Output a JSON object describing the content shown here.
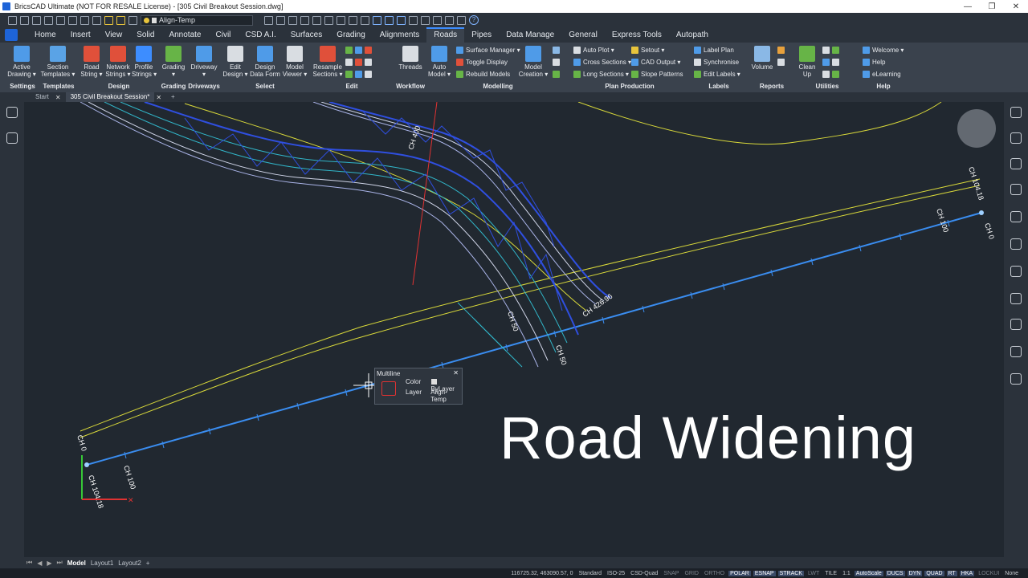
{
  "window": {
    "title": "BricsCAD Ultimate (NOT FOR RESALE License) - [305 Civil Breakout Session.dwg]",
    "min": "—",
    "max": "❐",
    "close": "✕"
  },
  "quick_access": {
    "layer": "Align-Temp",
    "help": "?"
  },
  "ribbon_tabs": [
    "Home",
    "Insert",
    "View",
    "Solid",
    "Annotate",
    "Civil",
    "CSD A.I.",
    "Surfaces",
    "Grading",
    "Alignments",
    "Roads",
    "Pipes",
    "Data Manage",
    "General",
    "Express Tools",
    "Autopath"
  ],
  "active_tab": "Roads",
  "ribbon": {
    "buttons": [
      {
        "label": "Active\nDrawing ▾",
        "icon": "active-drawing-icon",
        "color": "#4f9be8"
      },
      {
        "label": "Section\nTemplates ▾",
        "icon": "section-templates-icon",
        "color": "#5aa3e6"
      },
      {
        "label": "Road\nString ▾",
        "icon": "road-string-icon",
        "color": "#e0503a"
      },
      {
        "label": "Network\nStrings ▾",
        "icon": "network-strings-icon",
        "color": "#e0503a"
      },
      {
        "label": "Profile\nStrings ▾",
        "icon": "profile-strings-icon",
        "color": "#3d8dff"
      },
      {
        "label": "Grading\n▾",
        "icon": "grading-icon",
        "color": "#67b447"
      },
      {
        "label": "Driveway\n▾",
        "icon": "driveway-icon",
        "color": "#4f9be8"
      },
      {
        "label": "Edit\nDesign ▾",
        "icon": "edit-design-icon",
        "color": "#d9dde2"
      },
      {
        "label": "Design\nData Form",
        "icon": "design-data-form-icon",
        "color": "#4f9be8"
      },
      {
        "label": "Model\nViewer ▾",
        "icon": "model-viewer-icon",
        "color": "#d9dde2"
      },
      {
        "label": "Resample\nSections ▾",
        "icon": "resample-sections-icon",
        "color": "#e0503a"
      },
      {
        "label": "Threads",
        "icon": "threads-icon",
        "color": "#d9dde2"
      },
      {
        "label": "Auto\nModel ▾",
        "icon": "auto-model-icon",
        "color": "#4f9be8"
      },
      {
        "label": "Model\nCreation ▾",
        "icon": "model-creation-icon",
        "color": "#4f9be8"
      },
      {
        "label": "Volume",
        "icon": "volume-icon",
        "color": "#8ab8e6"
      },
      {
        "label": "Clean\nUp",
        "icon": "clean-up-icon",
        "color": "#67b447"
      }
    ],
    "small": [
      {
        "label": "Surface Manager ▾",
        "icon": "surface-manager-icon"
      },
      {
        "label": "Toggle Display",
        "icon": "toggle-display-icon"
      },
      {
        "label": "Rebuild Models",
        "icon": "rebuild-models-icon"
      },
      {
        "label": "Auto Plot ▾",
        "icon": "auto-plot-icon"
      },
      {
        "label": "Cross Sections ▾",
        "icon": "cross-sections-icon"
      },
      {
        "label": "Long Sections ▾",
        "icon": "long-sections-icon"
      },
      {
        "label": "Setout ▾",
        "icon": "setout-icon"
      },
      {
        "label": "CAD Output ▾",
        "icon": "cad-output-icon"
      },
      {
        "label": "Slope Patterns",
        "icon": "slope-patterns-icon"
      },
      {
        "label": "Label Plan",
        "icon": "label-plan-icon"
      },
      {
        "label": "Synchronise",
        "icon": "synchronise-icon"
      },
      {
        "label": "Edit Labels ▾",
        "icon": "edit-labels-icon"
      },
      {
        "label": "Welcome ▾",
        "icon": "welcome-icon"
      },
      {
        "label": "Help",
        "icon": "help-icon"
      },
      {
        "label": "eLearning",
        "icon": "elearning-icon"
      }
    ],
    "groups": [
      "Settings",
      "Templates",
      "Design",
      "Grading",
      "Driveways",
      "Select",
      "Edit",
      "Workflow",
      "Modelling",
      "Plan Production",
      "Labels",
      "Reports",
      "Utilities",
      "Help"
    ]
  },
  "doc_tabs": {
    "start": "Start",
    "active": "305 Civil Breakout Session*",
    "new": "+"
  },
  "drawing": {
    "labels": {
      "ch400": "CH 400",
      "ch100_right": "CH 100",
      "ch10418_right": "CH 104.18",
      "ch0_right": "CH 0",
      "ch42696": "CH 426.96",
      "ch50a": "CH 50",
      "ch50b": "CH 50",
      "ch0_left": "CH 0",
      "ch100_left": "CH 100",
      "ch10418_left": "CH 104.18"
    },
    "overlay_title": "Road Widening",
    "colors": {
      "blue": "#3a8df0",
      "yellow": "#d9d93a",
      "cyan": "#31b6c9",
      "red": "#e03232",
      "road_blue": "#2f4fe0"
    }
  },
  "quad": {
    "title": "Multiline",
    "close": "✕",
    "color_key": "Color",
    "color_value": "ByLayer",
    "layer_key": "Layer",
    "layer_value": "Align-Temp"
  },
  "layout_tabs": {
    "model": "Model",
    "layout1": "Layout1",
    "layout2": "Layout2",
    "add": "+"
  },
  "status": {
    "coords": "116725.32, 463090.57, 0",
    "items": [
      "Standard",
      "ISO-25",
      "CSD-Quad",
      "SNAP",
      "GRID",
      "ORTHO",
      "POLAR",
      "ESNAP",
      "STRACK",
      "LWT",
      "TILE",
      "1:1",
      "AutoScale",
      "DUCS",
      "DYN",
      "QUAD",
      "RT",
      "HKA",
      "LOCKUI",
      "None"
    ],
    "on": [
      "POLAR",
      "ESNAP",
      "STRACK",
      "AutoScale",
      "DUCS",
      "DYN",
      "QUAD",
      "RT",
      "HKA"
    ]
  }
}
